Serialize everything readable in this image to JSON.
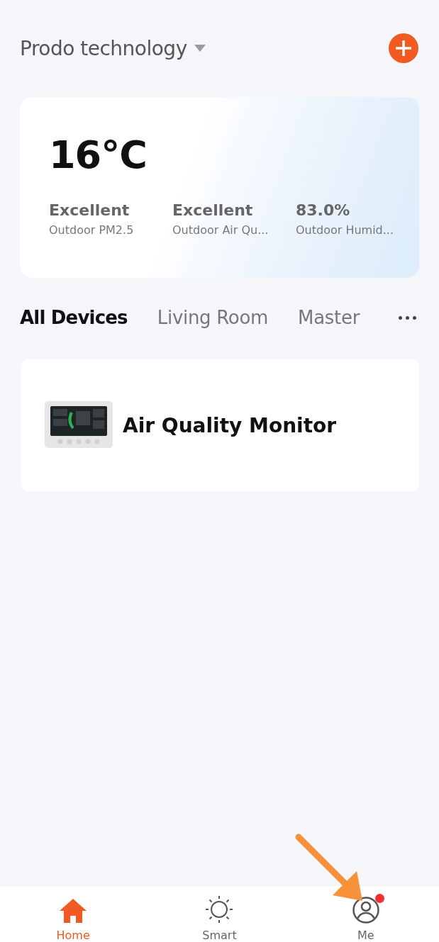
{
  "header": {
    "home_name": "Prodo technology"
  },
  "weather": {
    "temperature": "16°C",
    "stats": [
      {
        "value": "Excellent",
        "label": "Outdoor PM2.5"
      },
      {
        "value": "Excellent",
        "label": "Outdoor Air Qu..."
      },
      {
        "value": "83.0%",
        "label": "Outdoor Humid..."
      }
    ]
  },
  "room_tabs": [
    {
      "label": "All Devices",
      "selected": true
    },
    {
      "label": "Living Room",
      "selected": false
    },
    {
      "label": "Master",
      "selected": false
    }
  ],
  "devices": [
    {
      "name": "Air Quality Monitor",
      "kind": "picture"
    }
  ],
  "bottom_nav": [
    {
      "label": "Home",
      "kind": "home",
      "selected": true,
      "badge": false
    },
    {
      "label": "Smart",
      "kind": "smart",
      "selected": false,
      "badge": false
    },
    {
      "label": "Me",
      "kind": "me",
      "selected": false,
      "badge": true
    }
  ]
}
